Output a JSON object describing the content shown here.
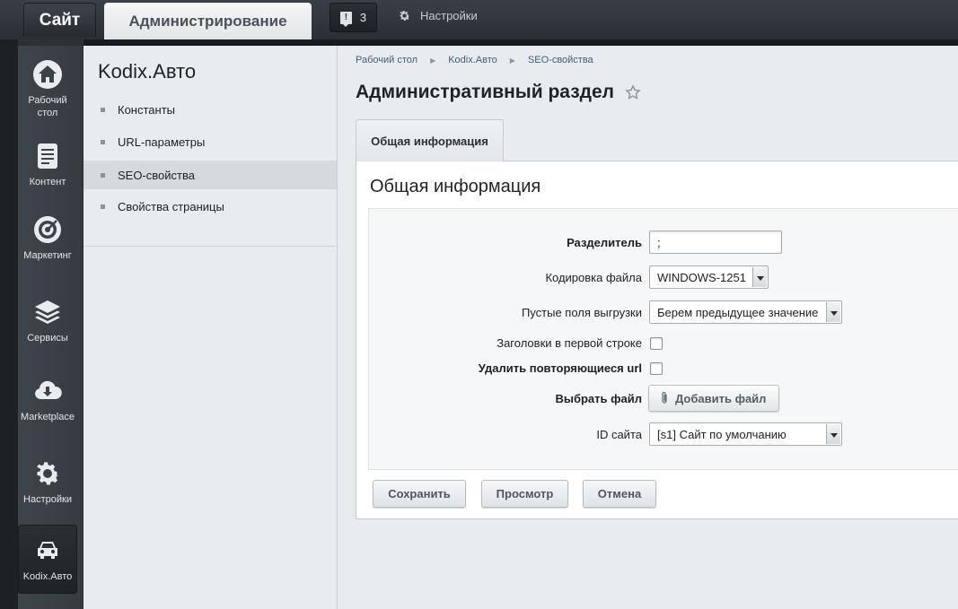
{
  "topbar": {
    "site_tab": "Сайт",
    "admin_tab": "Администрирование",
    "notifications_count": "3",
    "settings_label": "Настройки"
  },
  "nav": {
    "items": [
      {
        "label": "Рабочий стол",
        "icon": "home-icon"
      },
      {
        "label": "Контент",
        "icon": "document-icon"
      },
      {
        "label": "Маркетинг",
        "icon": "target-icon"
      },
      {
        "label": "Сервисы",
        "icon": "layers-icon"
      },
      {
        "label": "Marketplace",
        "icon": "cloud-download-icon"
      },
      {
        "label": "Настройки",
        "icon": "gear-icon"
      },
      {
        "label": "Kodix.Авто",
        "icon": "car-icon"
      }
    ]
  },
  "sidebar": {
    "title": "Kodix.Авто",
    "items": [
      {
        "label": "Константы"
      },
      {
        "label": "URL-параметры"
      },
      {
        "label": "SEO-свойства",
        "active": true
      },
      {
        "label": "Свойства страницы"
      }
    ]
  },
  "breadcrumb": [
    "Рабочий стол",
    "Kodix.Авто",
    "SEO-свойства"
  ],
  "page": {
    "title": "Административный раздел"
  },
  "tab": {
    "label": "Общая информация"
  },
  "panel": {
    "title": "Общая информация"
  },
  "form": {
    "separator_label": "Разделитель",
    "separator_value": ";",
    "encoding_label": "Кодировка файла",
    "encoding_value": "WINDOWS-1251",
    "empty_fields_label": "Пустые поля выгрузки",
    "empty_fields_value": "Берем предыдущее значение",
    "headers_label": "Заголовки в первой строке",
    "remove_dup_label": "Удалить повторяющиеся url",
    "file_label": "Выбрать файл",
    "add_file_label": "Добавить файл",
    "site_id_label": "ID сайта",
    "site_id_value": "[s1] Сайт по умолчанию"
  },
  "actions": {
    "save": "Сохранить",
    "preview": "Просмотр",
    "cancel": "Отмена"
  }
}
